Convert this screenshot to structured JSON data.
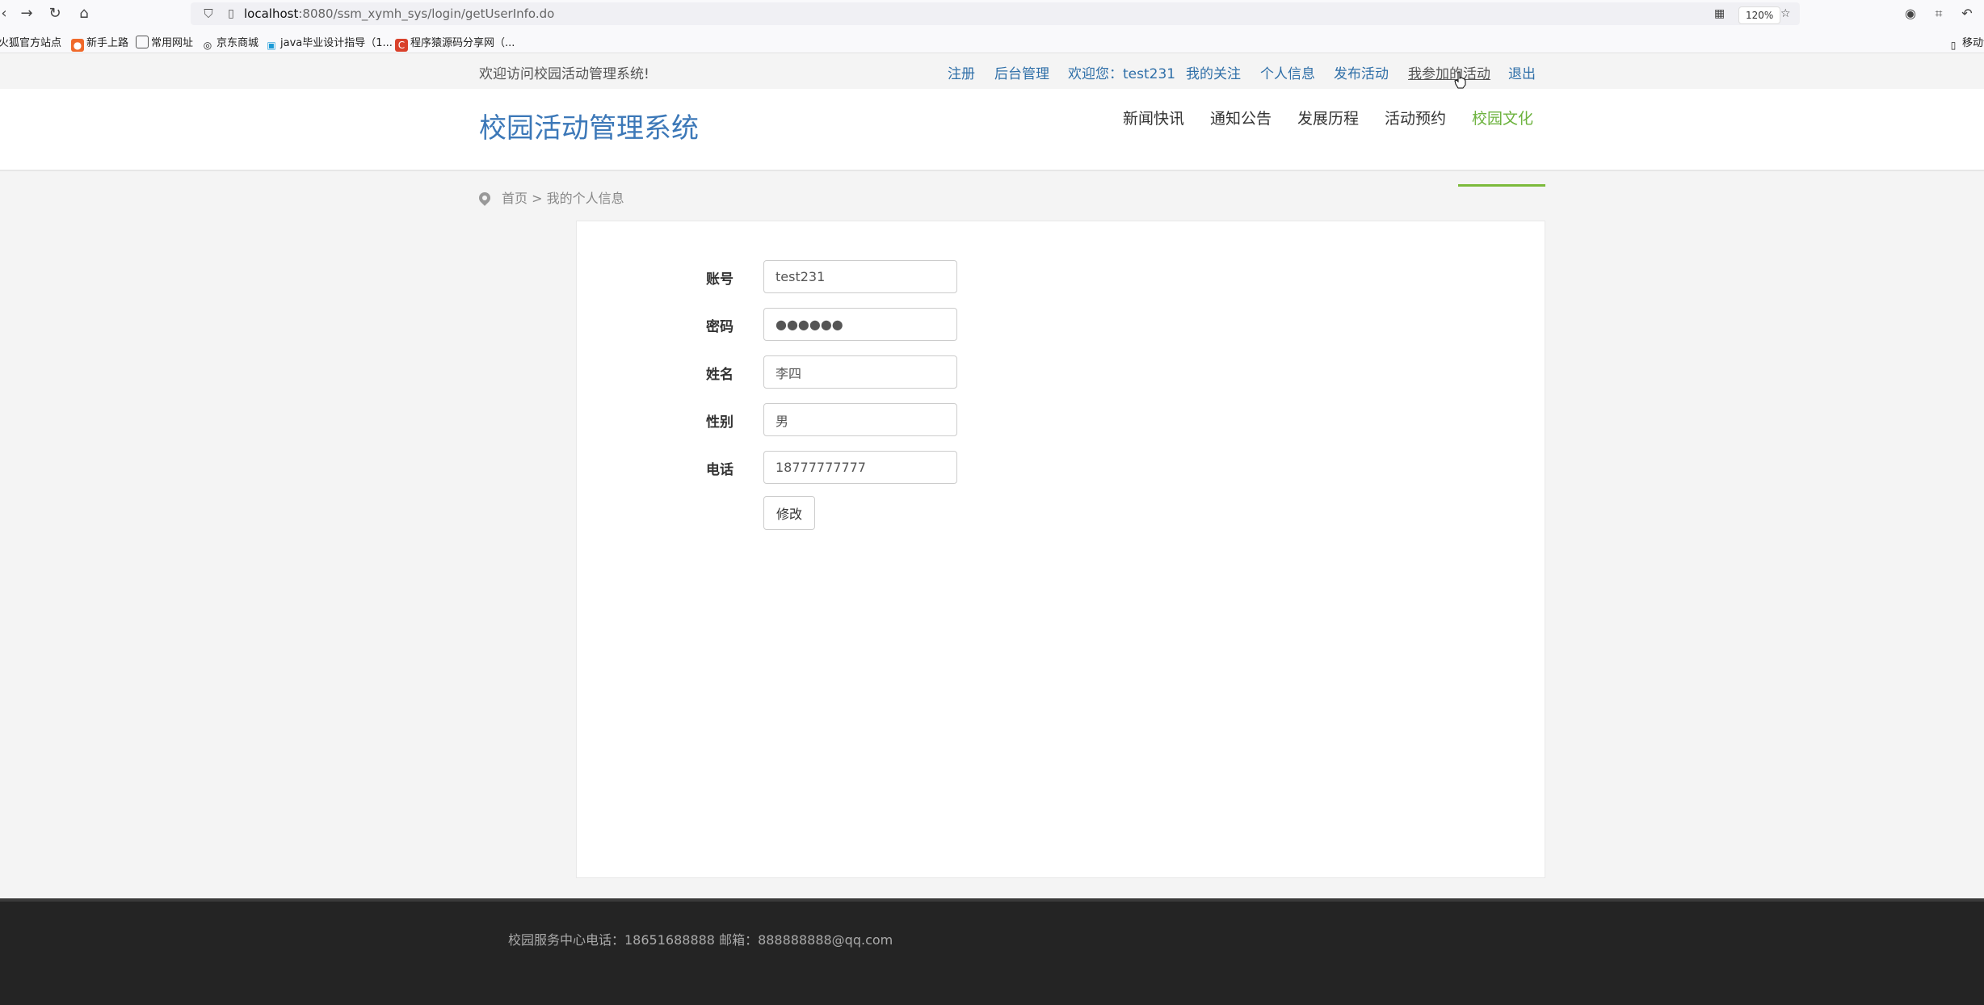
{
  "browser": {
    "url_host": "localhost",
    "url_path": ":8080/ssm_xymh_sys/login/getUserInfo.do",
    "zoom": "120%",
    "bookmarks": [
      "火狐官方站点",
      "新手上路",
      "常用网址",
      "京东商城",
      "java毕业设计指导（1...",
      "程序猿源码分享网（..."
    ],
    "mobile_bookmarks": "移动设"
  },
  "topbar": {
    "welcome": "欢迎访问校园活动管理系统!",
    "links": [
      "注册",
      "后台管理",
      "欢迎您：test231",
      "我的关注",
      "个人信息",
      "发布活动",
      "我参加的活动",
      "退出"
    ]
  },
  "header": {
    "site_title": "校园活动管理系统",
    "nav": [
      "新闻快讯",
      "通知公告",
      "发展历程",
      "活动预约",
      "校园文化"
    ]
  },
  "breadcrumb": "首页 > 我的个人信息",
  "form": {
    "fields": [
      {
        "label": "账号",
        "value": "test231"
      },
      {
        "label": "密码",
        "value": "●●●●●●"
      },
      {
        "label": "姓名",
        "value": "李四"
      },
      {
        "label": "性别",
        "value": "男"
      },
      {
        "label": "电话",
        "value": "18777777777"
      }
    ],
    "submit_label": "修改"
  },
  "footer": {
    "text": "校园服务中心电话：18651688888   邮箱：888888888@qq.com"
  },
  "colors": {
    "link_blue": "#2f6fa8",
    "title_blue": "#3c78b8",
    "nav_green": "#6db33f",
    "footer_bg": "#242424"
  }
}
